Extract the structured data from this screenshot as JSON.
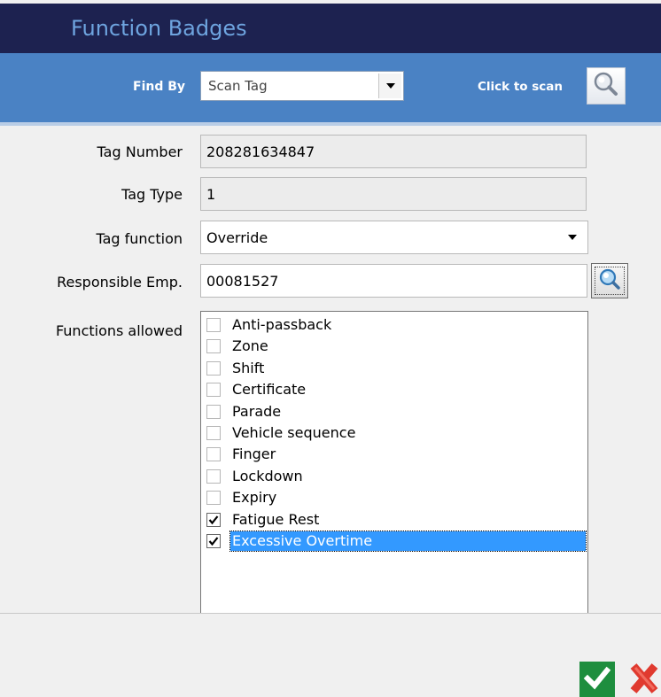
{
  "window": {
    "title": "Function Badges"
  },
  "find_bar": {
    "find_by_label": "Find By",
    "find_by_value": "Scan Tag",
    "scan_label": "Click to scan",
    "scan_icon": "magnifier-icon"
  },
  "form": {
    "tag_number_label": "Tag Number",
    "tag_number_value": "208281634847",
    "tag_type_label": "Tag Type",
    "tag_type_value": "1",
    "tag_function_label": "Tag function",
    "tag_function_value": "Override",
    "responsible_label": "Responsible Emp.",
    "responsible_value": "00081527",
    "functions_label": "Functions allowed"
  },
  "functions": [
    {
      "label": "Anti-passback",
      "checked": false,
      "selected": false
    },
    {
      "label": "Zone",
      "checked": false,
      "selected": false
    },
    {
      "label": "Shift",
      "checked": false,
      "selected": false
    },
    {
      "label": "Certificate",
      "checked": false,
      "selected": false
    },
    {
      "label": "Parade",
      "checked": false,
      "selected": false
    },
    {
      "label": "Vehicle sequence",
      "checked": false,
      "selected": false
    },
    {
      "label": "Finger",
      "checked": false,
      "selected": false
    },
    {
      "label": "Lockdown",
      "checked": false,
      "selected": false
    },
    {
      "label": "Expiry",
      "checked": false,
      "selected": false
    },
    {
      "label": "Fatigue Rest",
      "checked": true,
      "selected": false
    },
    {
      "label": "Excessive Overtime",
      "checked": true,
      "selected": true
    }
  ],
  "footer": {
    "ok_icon": "checkmark-icon",
    "cancel_icon": "close-icon"
  },
  "colors": {
    "titlebar": "#1d2250",
    "title_text": "#6ea4df",
    "findbar": "#4a82c4",
    "selection": "#3399ff",
    "ok": "#1e8e3e",
    "cancel": "#e03a2f"
  }
}
